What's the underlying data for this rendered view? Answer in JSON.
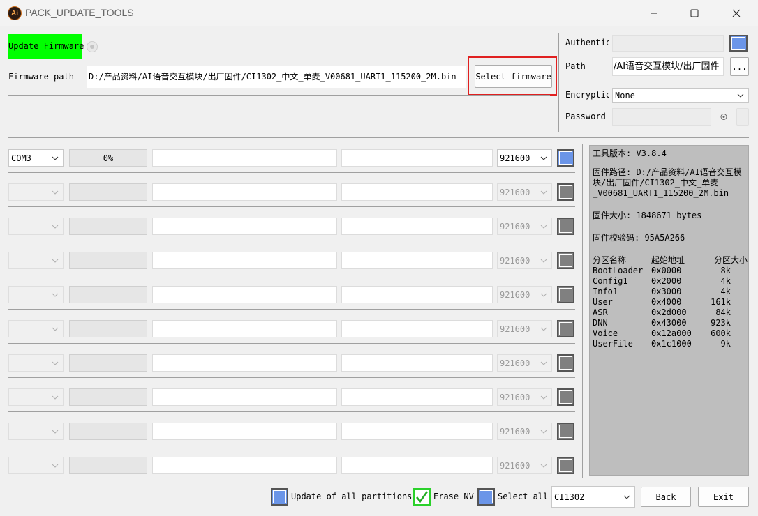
{
  "window": {
    "title": "PACK_UPDATE_TOOLS",
    "app_icon": "Ai"
  },
  "top": {
    "update_firmware_label": "Update Firmware",
    "firmware_path_label": "Firmware path",
    "firmware_path_value": "D:/产品资料/AI语音交互模块/出厂固件/CI1302_中文_单麦_V00681_UART1_115200_2M.bin",
    "select_firmware_label": "Select firmware"
  },
  "right_top": {
    "authentic_label": "Authentic",
    "path_label": "Path",
    "path_value": "/AI语音交互模块/出厂固件",
    "browse_label": "...",
    "encryption_label": "Encryptic",
    "encryption_value": "None",
    "password_label": "Password"
  },
  "ports": [
    {
      "com": "COM3",
      "progress": "0%",
      "baud": "921600",
      "active": true
    },
    {
      "com": "",
      "progress": "",
      "baud": "921600",
      "active": false
    },
    {
      "com": "",
      "progress": "",
      "baud": "921600",
      "active": false
    },
    {
      "com": "",
      "progress": "",
      "baud": "921600",
      "active": false
    },
    {
      "com": "",
      "progress": "",
      "baud": "921600",
      "active": false
    },
    {
      "com": "",
      "progress": "",
      "baud": "921600",
      "active": false
    },
    {
      "com": "",
      "progress": "",
      "baud": "921600",
      "active": false
    },
    {
      "com": "",
      "progress": "",
      "baud": "921600",
      "active": false
    },
    {
      "com": "",
      "progress": "",
      "baud": "921600",
      "active": false
    },
    {
      "com": "",
      "progress": "",
      "baud": "921600",
      "active": false
    }
  ],
  "info": {
    "tool_version": "工具版本: V3.8.4",
    "fw_path_1": "固件路径: D:/产品资料/AI语音交互模",
    "fw_path_2": "块/出厂固件/CI1302_中文_单麦",
    "fw_path_3": "_V00681_UART1_115200_2M.bin",
    "fw_size": "固件大小: 1848671 bytes",
    "fw_checksum": "固件校验码: 95A5A266",
    "partition_headers": [
      "分区名称",
      "起始地址",
      "分区大小"
    ],
    "partitions": [
      [
        "BootLoader",
        "0x0000",
        "8k"
      ],
      [
        "Config1",
        "0x2000",
        "4k"
      ],
      [
        "Info1",
        "0x3000",
        "4k"
      ],
      [
        "User",
        "0x4000",
        "161k"
      ],
      [
        "ASR",
        "0x2d000",
        "84k"
      ],
      [
        "DNN",
        "0x43000",
        "923k"
      ],
      [
        "Voice",
        "0x12a000",
        "600k"
      ],
      [
        "UserFile",
        "0x1c1000",
        "9k"
      ]
    ]
  },
  "bottom": {
    "update_all_label": "Update of all partitions",
    "erase_nv_label": "Erase NV",
    "select_all_label": "Select all",
    "chip_value": "CI1302",
    "back_label": "Back",
    "exit_label": "Exit"
  },
  "colors": {
    "accent_green": "#00ff00",
    "check_blue": "#6b95e8",
    "highlight_red": "#e02020"
  }
}
